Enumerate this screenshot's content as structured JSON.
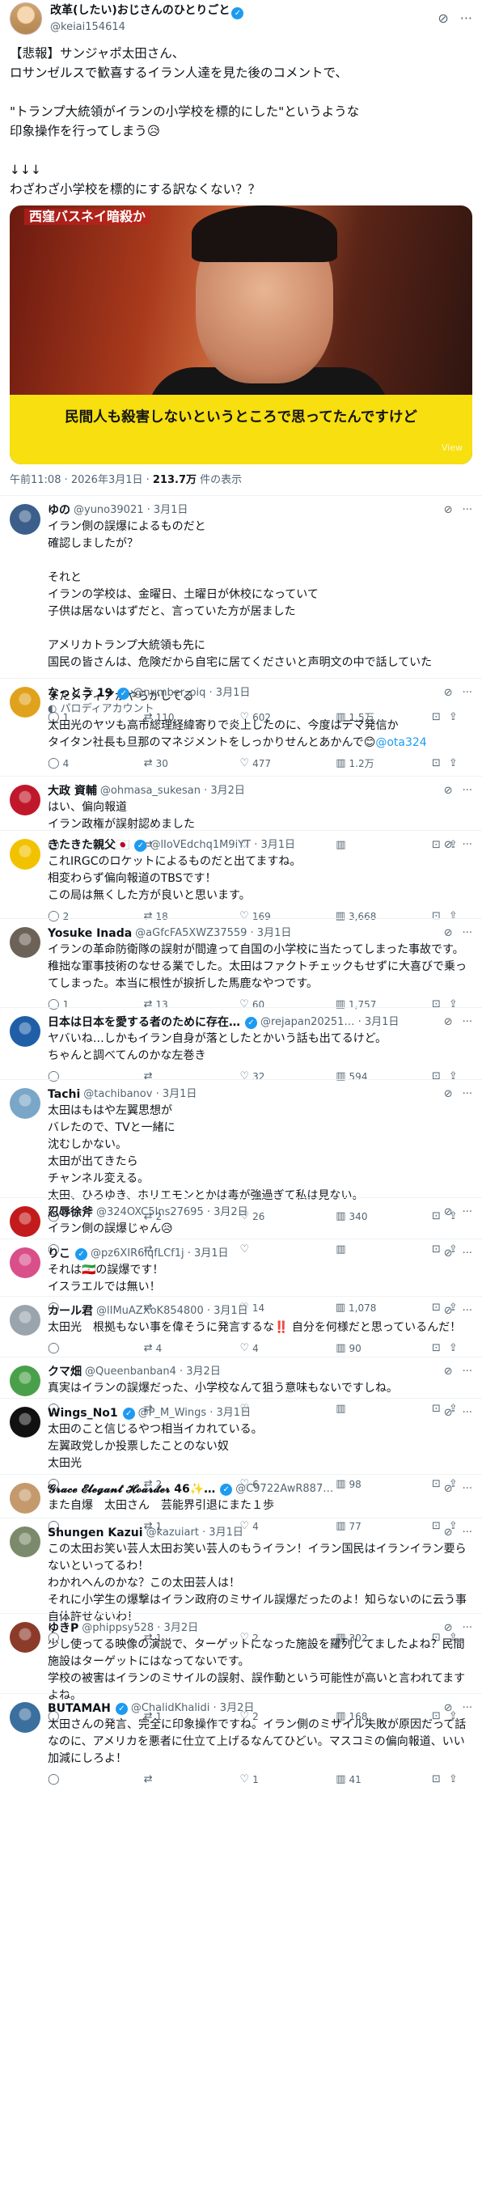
{
  "main": {
    "name": "改革(したい)おじさんのひとりごと",
    "handle": "@keiai154614",
    "text": "【悲報】サンジャポ太田さん、\nロサンゼルスで歓喜するイラン人達を見た後のコメントで、\n\n\"トランプ大統領がイランの小学校を標的にした\"というような\n印象操作を行ってしまう😥\n\n↓↓↓\nわざわざ小学校を標的にする訳なくない？？",
    "media_top_label": "西窪バスネイ暗殺か",
    "media_caption": "民間人も殺害しないというところで思ってたんですけど",
    "media_badge": "View",
    "time": "午前11:08 · 2026年3月1日 · ",
    "views": "213.7万",
    "views_suffix": " 件の表示"
  },
  "replies": [
    {
      "name": "ゆの",
      "handle": "@yuno39021 · 3月1日",
      "text": "イラン側の誤爆によるものだと\n確認しましたが？\n\nそれと\nイランの学校は、金曜日、土曜日が休校になっていて\n子供は居ないはずだと、言っていた方が居ました\n\nアメリカトランプ大統領も先に\n国民の皆さんは、危険だから自宅に居てくださいと声明文の中で話していた\n\nまたメディアがやらかしてる",
      "verified": false,
      "reply": "1",
      "repost": "110",
      "like": "602",
      "views": "1.5万",
      "avatar": "#3b5f8a"
    },
    {
      "name": "なっとう 19",
      "handle": "@number_oiq · 3月1日",
      "parody": "パロディアカウント",
      "text": "太田光のヤツも高市総理経緯寄りで炎上したのに、今度はデマ発信か\nタイタン社長も旦那のマネジメントをしっかりせんとあかんで😊",
      "link": "@ota324",
      "verified": true,
      "reply": "4",
      "repost": "30",
      "like": "477",
      "views": "1.2万",
      "avatar": "#e0a21d"
    },
    {
      "name": "大政 資輔",
      "handle": "@ohmasa_sukesan · 3月2日",
      "text": "はい、偏向報道\nイラン政権が誤射認めました",
      "verified": false,
      "reply": "",
      "repost": "",
      "like": "",
      "views": "",
      "avatar": "#c0182a"
    },
    {
      "name": "きたきた親父🇯🇵",
      "handle": "@lIoVEdchq1M9iYT · 3月1日",
      "text": "これIRGCのロケットによるものだと出てますね。\n相変わらず偏向報道のTBSです！\nこの局は無くした方が良いと思います。",
      "verified": true,
      "reply": "2",
      "repost": "18",
      "like": "169",
      "views": "3,668",
      "avatar": "#f2c200"
    },
    {
      "name": "Yosuke Inada",
      "handle": "@aGfcFA5XWZ37559 · 3月1日",
      "text": "イランの革命防衛隊の誤射が間違って自国の小学校に当たってしまった事故です。稚拙な軍事技術のなせる業でした。太田はファクトチェックもせずに大喜びで乗ってしまった。本当に根性が捩折した馬鹿なやつです。",
      "verified": false,
      "reply": "1",
      "repost": "13",
      "like": "60",
      "views": "1,757",
      "avatar": "#6d6257"
    },
    {
      "name": "日本は日本を愛する者のために存在…",
      "handle": "@rejapan20251… · 3月1日",
      "text": "ヤバいね…しかもイラン自身が落としたとかいう話も出てるけど。\nちゃんと調べてんのかな左巻き",
      "verified": true,
      "reply": "",
      "repost": "",
      "like": "32",
      "views": "594",
      "avatar": "#1f5fa8"
    },
    {
      "name": "Tachi",
      "handle": "@tachibanov · 3月1日",
      "text": "太田はもはや左翼思想が\nバレたので、TVと一緒に\n沈むしかない。\n太田が出てきたら\nチャンネル変える。\n太田、ひろゆき、ホリエモンとかは毒が強過ぎて私は見ない。",
      "verified": false,
      "reply": "",
      "repost": "2",
      "like": "26",
      "views": "340",
      "avatar": "#7aa6c7"
    },
    {
      "name": "忍辱徐斧",
      "handle": "@324OXC5Ins27695 · 3月2日",
      "text": "イラン側の誤爆じゃん😥",
      "verified": false,
      "reply": "",
      "repost": "",
      "like": "",
      "views": "",
      "avatar": "#c31b1b"
    },
    {
      "name": "りこ",
      "handle": "@pz6XIR6iqfLCf1j · 3月1日",
      "text": "それは🇮🇷の誤爆です！\nイスラエルでは無い！",
      "verified": true,
      "reply": "",
      "repost": "",
      "like": "14",
      "views": "1,078",
      "avatar": "#d94f8a"
    },
    {
      "name": "カール君",
      "handle": "@lIMuAZXoK854800 · 3月1日",
      "text": "太田光　根拠もない事を偉そうに発言するな‼️ 自分を何様だと思っているんだ！",
      "verified": false,
      "reply": "",
      "repost": "4",
      "like": "4",
      "views": "90",
      "avatar": "#9aa4ad"
    },
    {
      "name": "クマ畑",
      "handle": "@Queenbanban4 · 3月2日",
      "text": "真実はイランの誤爆だった、小学校なんて狙う意味もないですしね。",
      "verified": false,
      "reply": "",
      "repost": "",
      "like": "",
      "views": "",
      "avatar": "#4aa04a"
    },
    {
      "name": "Wings_No1",
      "handle": "@P_M_Wings · 3月1日",
      "text": "太田のこと信じるやつ相当イカれている。\n左翼政党しか投票したことのない奴\n太田光",
      "verified": true,
      "reply": "",
      "repost": "2",
      "like": "6",
      "views": "98",
      "avatar": "#111111"
    },
    {
      "name": "𝓖𝓻𝓪𝓬𝓮 𝓔𝓵𝓮𝓰𝓪𝓷𝓽 𝓗𝓸𝓪𝓻𝓭𝓮𝓻 46✨…",
      "handle": "@C9722AwR887…",
      "text": "また自爆　太田さん　芸能界引退にまた１歩",
      "verified": true,
      "reply": "",
      "repost": "1",
      "like": "4",
      "views": "77",
      "avatar": "#c49a6c"
    },
    {
      "name": "Shungen Kazui",
      "handle": "@kazuiart · 3月1日",
      "text": "この太田お笑い芸人太田お笑い芸人のもうイラン！イラン国民はイランイラン要らないといってるわ！\nわかれへんのかな？この太田芸人は！\nそれに小学生の爆撃はイラン政府のミサイル誤爆だったのよ！知らないのに云う事自体許せないわ！",
      "verified": false,
      "reply": "",
      "repost": "1",
      "like": "2",
      "views": "302",
      "avatar": "#7b8a6a"
    },
    {
      "name": "ゆきP",
      "handle": "@phippsy528 · 3月2日",
      "text": "少し使ってる映像の演説で、ターゲットになった施設を羅列してましたよね？民間施設はターゲットにはなってないです。\n学校の被害はイランのミサイルの誤射、誤作動という可能性が高いと言われてますよね。",
      "verified": false,
      "reply": "",
      "repost": "1",
      "like": "2",
      "views": "168",
      "avatar": "#8c3b2a"
    },
    {
      "name": "BUTAMAH",
      "handle": "@ChalidKhalidi · 3月2日",
      "text": "太田さんの発言、完全に印象操作ですね。イラン側のミサイル失敗が原因だって話なのに、アメリカを悪者に仕立て上げるなんてひどい。マスコミの偏向報道、いい加減にしろよ！",
      "verified": true,
      "reply": "",
      "repost": "",
      "like": "1",
      "views": "41",
      "avatar": "#3a6f9e"
    }
  ]
}
